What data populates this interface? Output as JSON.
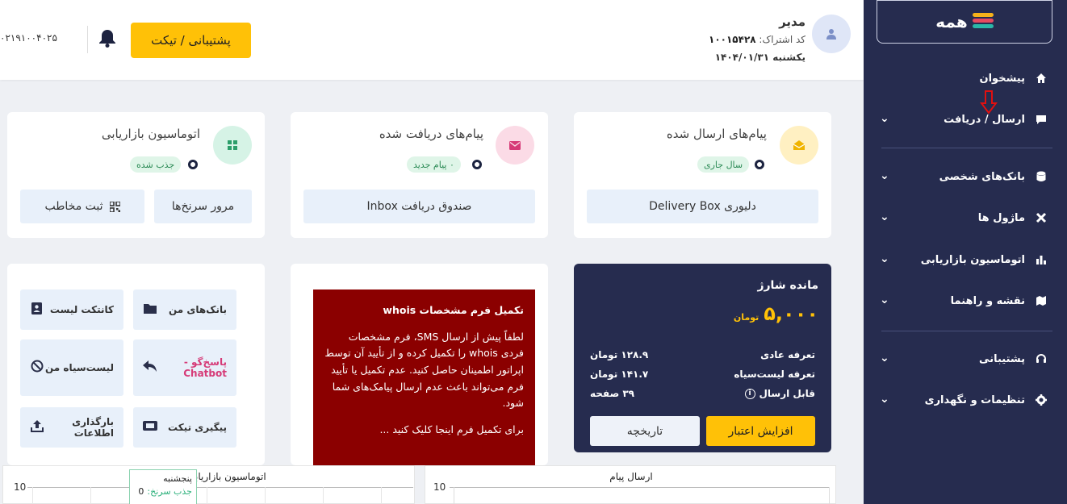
{
  "brand": {
    "logo_text": "همه",
    "colors": [
      "#f5b21a",
      "#e84a5f",
      "#2bb7a8",
      "#7bc043"
    ]
  },
  "header": {
    "user_name": "مدیر",
    "subscription_label": "کد اشتراک:",
    "subscription_code": "۱۰۰۱۵۴۲۸",
    "date": "یکشنبه ۱۴۰۴/۰۱/۳۱",
    "support_button": "پشتیبانی / تیکت",
    "phone": "۰۲۱۹۱۰۰۴۰۲۵",
    "avatar_icon": "user-icon",
    "bell_icon": "bell-icon"
  },
  "sidebar": {
    "items": [
      {
        "label": "پیشخوان",
        "icon": "home-icon",
        "chevron": false
      },
      {
        "label": "ارسال / دریافت",
        "icon": "message-icon",
        "chevron": true
      },
      {
        "label": "بانک‌های شخصی",
        "icon": "database-icon",
        "chevron": true
      },
      {
        "label": "ماژول ها",
        "icon": "tools-icon",
        "chevron": true
      },
      {
        "label": "اتوماسیون بازاریابی",
        "icon": "chart-icon",
        "chevron": true
      },
      {
        "label": "نقشه و راهنما",
        "icon": "map-icon",
        "chevron": true
      },
      {
        "label": "پشتیبانی",
        "icon": "headset-icon",
        "chevron": true
      },
      {
        "label": "تنظیمات و نگهداری",
        "icon": "gear-icon",
        "chevron": true
      }
    ]
  },
  "cards": {
    "sent": {
      "title": "پیام‌های ارسال شده",
      "badge": "سال جاری",
      "button": "دلیوری Delivery Box"
    },
    "received": {
      "title": "پیام‌های دریافت شده",
      "badge": "۰ پیام جدید",
      "button": "صندوق دریافت Inbox"
    },
    "automation": {
      "title": "اتوماسیون بازاریابی",
      "badge": "جذب شده",
      "button_right": "مرور سرنخ‌ها",
      "button_left": "ثبت مخاطب"
    }
  },
  "charge": {
    "title": "مانده شارژ",
    "amount": "۵,۰۰۰",
    "currency": "تومان",
    "rows": [
      {
        "label": "تعرفه عادی",
        "value": "۱۲۸.۹ تومان"
      },
      {
        "label": "تعرفه لیست‌سیاه",
        "value": "۱۴۱.۷ تومان"
      },
      {
        "label": "قابل ارسال",
        "value": "۳۹ صفحه"
      }
    ],
    "increase_button": "افزایش اعتبار",
    "history_button": "تاریخچه"
  },
  "notice": {
    "title": "تکمیل فرم مشخصات whois",
    "body": "لطفاً پیش از ارسال SMS، فرم مشخصات فردی whois را تکمیل کرده و از تأیید آن توسط اپراتور اطمینان حاصل کنید. عدم تکمیل یا تأیید فرم می‌تواند باعث عدم ارسال پیامک‌های شما شود.",
    "cta": "برای تکمیل فرم اینجا کلیک کنید ..."
  },
  "quick_links": [
    {
      "label": "بانک‌های من",
      "icon": "folder-icon"
    },
    {
      "label": "کانتکت لیست",
      "icon": "contact-icon"
    },
    {
      "label": "پاسخ‌گو - Chatbot",
      "icon": "reply-icon"
    },
    {
      "label": "لیست‌سیاه من",
      "icon": "ban-icon"
    },
    {
      "label": "پیگیری تیکت",
      "icon": "ticket-icon"
    },
    {
      "label": "بارگذاری اطلاعات",
      "icon": "upload-icon"
    }
  ],
  "charts": {
    "send": {
      "title": "ارسال پیام",
      "y_tick": "10"
    },
    "automation": {
      "title": "اتوماسیون بازاریابی",
      "y_tick": "10",
      "tooltip_day": "پنجشنبه",
      "tooltip_label": "جذب سرنخ:",
      "tooltip_value": "0"
    }
  },
  "chart_data": [
    {
      "type": "line",
      "title": "ارسال پیام",
      "ylim": [
        0,
        10
      ]
    },
    {
      "type": "line",
      "title": "اتوماسیون بازاریابی",
      "ylim": [
        0,
        10
      ],
      "series": [
        {
          "name": "جذب سرنخ",
          "values": [
            0
          ]
        }
      ],
      "categories": [
        "پنجشنبه"
      ]
    }
  ]
}
